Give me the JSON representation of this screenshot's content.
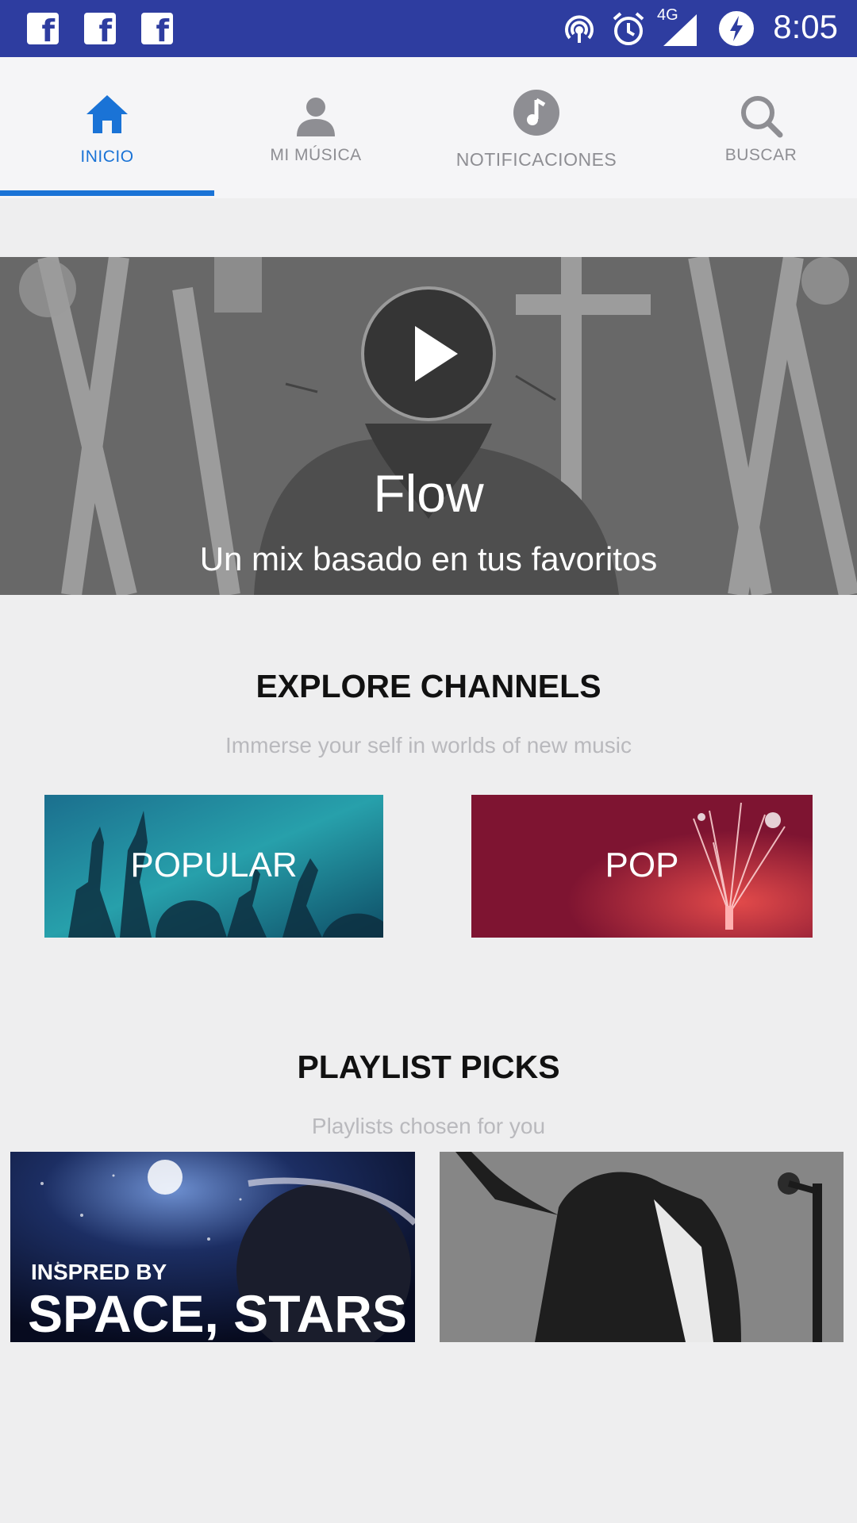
{
  "status_bar": {
    "notifications": [
      "facebook-icon",
      "facebook-icon",
      "facebook-icon"
    ],
    "network": "4G",
    "time": "8:05"
  },
  "tabs": [
    {
      "label": "INICIO",
      "icon": "home-icon",
      "active": true
    },
    {
      "label": "MI MÚSICA",
      "icon": "person-icon",
      "active": false
    },
    {
      "label": "NOTIFICACIONES",
      "icon": "music-note-icon",
      "active": false
    },
    {
      "label": "BUSCAR",
      "icon": "search-icon",
      "active": false
    }
  ],
  "hero": {
    "title": "Flow",
    "subtitle": "Un mix basado en tus favoritos"
  },
  "explore": {
    "title": "EXPLORE CHANNELS",
    "subtitle": "Immerse your self in worlds of new music",
    "channels": [
      {
        "label": "POPULAR",
        "color": "#1f7f96"
      },
      {
        "label": "POP",
        "color": "#7e1431"
      }
    ]
  },
  "playlists": {
    "title": "PLAYLIST PICKS",
    "subtitle": "Playlists chosen for you",
    "items": [
      {
        "caption_top": "INSPRED BY",
        "caption_main": "SPACE, STARS"
      },
      {
        "caption_top": "",
        "caption_main": ""
      }
    ]
  },
  "colors": {
    "status_bar": "#2e3da0",
    "accent": "#1a73d6",
    "background": "#eeeeef"
  }
}
